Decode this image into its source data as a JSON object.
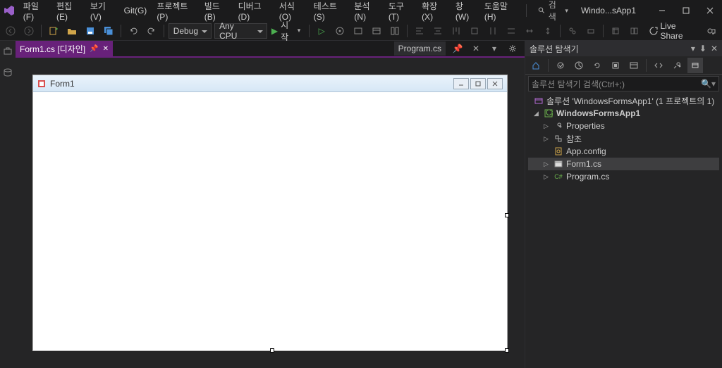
{
  "menu": {
    "file": "파일(F)",
    "edit": "편집(E)",
    "view": "보기(V)",
    "git": "Git(G)",
    "project": "프로젝트(P)",
    "build": "빌드(B)",
    "debug": "디버그(D)",
    "format": "서식(O)",
    "test": "테스트(S)",
    "analyze": "분석(N)",
    "tools": "도구(T)",
    "extensions": "확장(X)",
    "window": "창(W)",
    "help": "도움말(H)"
  },
  "search": {
    "label": "검색"
  },
  "app": {
    "title": "Windo...sApp1"
  },
  "toolbar": {
    "config": "Debug",
    "platform": "Any CPU",
    "start": "시작"
  },
  "liveshare": {
    "label": "Live Share"
  },
  "tabs": {
    "active": "Form1.cs [디자인]",
    "inactive": "Program.cs"
  },
  "form": {
    "title": "Form1"
  },
  "solution": {
    "panel_title": "솔루션 탐색기",
    "search_placeholder": "솔루션 탐색기 검색(Ctrl+;)",
    "root": "솔루션 'WindowsFormsApp1'  (1 프로젝트의 1)",
    "project": "WindowsFormsApp1",
    "properties": "Properties",
    "references": "참조",
    "appconfig": "App.config",
    "form": "Form1.cs",
    "program": "Program.cs"
  }
}
